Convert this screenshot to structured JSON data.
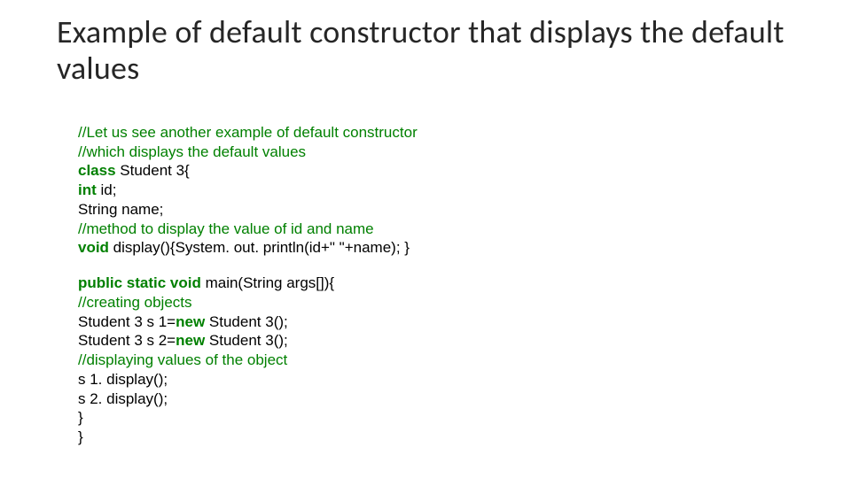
{
  "title": "Example of default constructor that displays the default values",
  "code": {
    "c1": "//Let us see another example of default constructor",
    "c2": "//which displays the default values",
    "kw_class": "class",
    "class_rest": " Student 3{",
    "kw_int": "int",
    "int_rest": " id;",
    "string_line": "String name;",
    "c3": "//method to display the value of id and name",
    "kw_void": "void",
    "void_rest": " display(){System. out. println(id+\" \"+name); }",
    "kw_psv": "public static void",
    "psv_rest": " main(String args[]){",
    "c4": "//creating objects",
    "s1a": "Student 3 s 1=",
    "kw_new1": "new",
    "s1b": " Student 3();",
    "s2a": "Student 3 s 2=",
    "kw_new2": "new",
    "s2b": " Student 3();",
    "c5": "//displaying values of the object",
    "d1": "s 1. display();",
    "d2": "s 2. display();",
    "br1": "}",
    "br2": "}"
  }
}
